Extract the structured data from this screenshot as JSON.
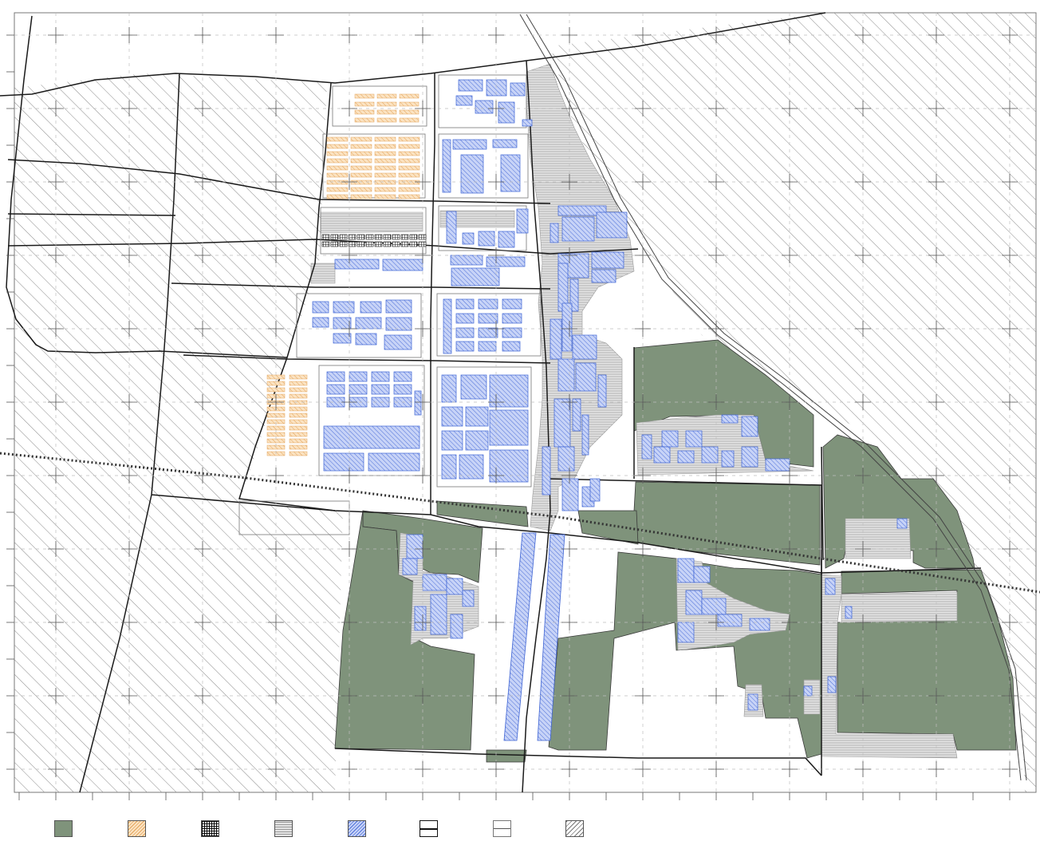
{
  "map": {
    "colors": {
      "green": "#7f937b",
      "orange": "#f2c48a",
      "blue": "#6e8ee6",
      "gray": "#c9c9c9",
      "road": "#1a1a1a",
      "hatch": "#8a8a8a"
    }
  },
  "legend": {
    "items": [
      {
        "name": "green-space-swatch",
        "kind": "green"
      },
      {
        "name": "orange-hatch-swatch",
        "kind": "orange"
      },
      {
        "name": "dark-grid-swatch",
        "kind": "darkgrid"
      },
      {
        "name": "gray-hatch-swatch",
        "kind": "gray"
      },
      {
        "name": "blue-hatch-swatch",
        "kind": "blue"
      },
      {
        "name": "boxed-line-swatch",
        "kind": "boxline"
      },
      {
        "name": "open-line-swatch",
        "kind": "openline"
      },
      {
        "name": "diagonal-hatch-swatch",
        "kind": "diag"
      }
    ]
  }
}
